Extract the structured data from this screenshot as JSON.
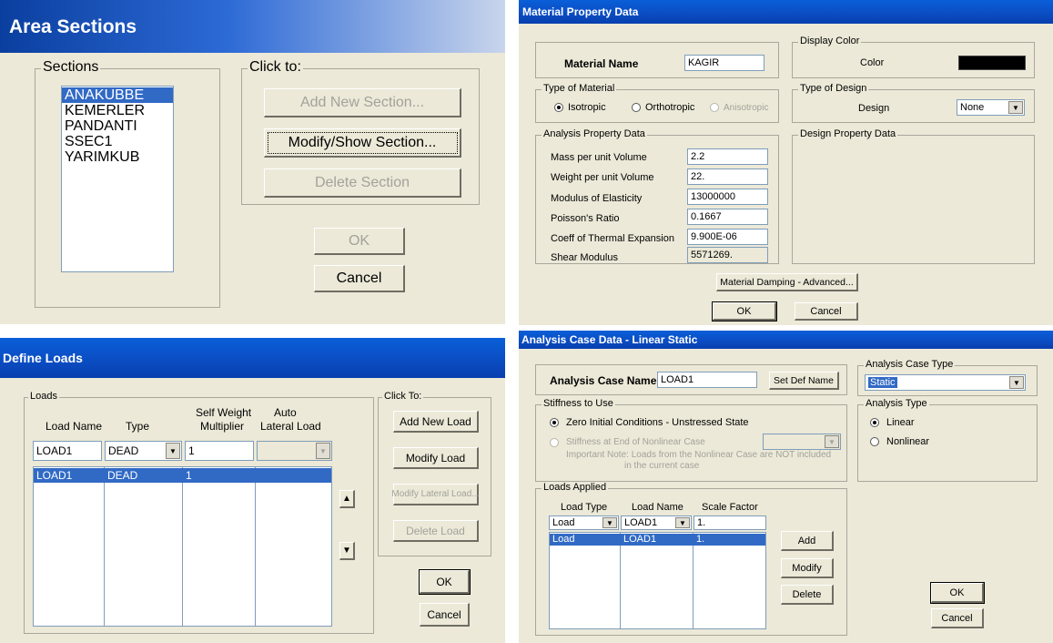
{
  "area_sections": {
    "title": "Area Sections",
    "sections_group": "Sections",
    "sections": [
      "ANAKUBBE",
      "KEMERLER",
      "PANDANTI",
      "SSEC1",
      "YARIMKUB"
    ],
    "click_group": "Click to:",
    "add_btn": "Add New Section...",
    "modify_btn": "Modify/Show Section...",
    "delete_btn": "Delete Section",
    "ok_btn": "OK",
    "cancel_btn": "Cancel"
  },
  "material": {
    "title": "Material Property Data",
    "name_label": "Material Name",
    "name_value": "KAGIR",
    "display_color_group": "Display Color",
    "color_label": "Color",
    "color_swatch": "#000000",
    "type_group": "Type of Material",
    "isotropic": "Isotropic",
    "orthotropic": "Orthotropic",
    "anisotropic": "Anisotropic",
    "design_group": "Type of Design",
    "design_label": "Design",
    "design_value": "None",
    "analysis_group": "Analysis Property Data",
    "props": [
      {
        "label": "Mass per unit Volume",
        "value": "2.2"
      },
      {
        "label": "Weight per unit Volume",
        "value": "22."
      },
      {
        "label": "Modulus of Elasticity",
        "value": "13000000"
      },
      {
        "label": "Poisson's Ratio",
        "value": "0.1667"
      },
      {
        "label": "Coeff of Thermal Expansion",
        "value": "9.900E-06"
      },
      {
        "label": "Shear Modulus",
        "value": "5571269."
      }
    ],
    "design_prop_group": "Design Property Data",
    "damping_btn": "Material Damping - Advanced...",
    "ok_btn": "OK",
    "cancel_btn": "Cancel"
  },
  "define_loads": {
    "title": "Define Loads",
    "loads_group": "Loads",
    "col_name": "Load Name",
    "col_type": "Type",
    "col_sw_1": "Self Weight",
    "col_sw_2": "Multiplier",
    "col_auto_1": "Auto",
    "col_auto_2": "Lateral Load",
    "input_name": "LOAD1",
    "input_type": "DEAD",
    "input_sw": "1",
    "row": {
      "name": "LOAD1",
      "type": "DEAD",
      "sw": "1",
      "auto": ""
    },
    "click_group": "Click To:",
    "add_btn": "Add New Load",
    "modify_btn": "Modify Load",
    "modify_lateral_btn": "Modify Lateral Load...",
    "delete_btn": "Delete Load",
    "ok_btn": "OK",
    "cancel_btn": "Cancel"
  },
  "analysis_case": {
    "title": "Analysis Case Data - Linear Static",
    "name_label": "Analysis Case Name",
    "name_value": "LOAD1",
    "set_def_btn": "Set Def Name",
    "case_type_group": "Analysis Case Type",
    "case_type_value": "Static",
    "stiffness_group": "Stiffness to Use",
    "zero_initial": "Zero Initial Conditions - Unstressed State",
    "stiffness_end": "Stiffness at End of Nonlinear Case",
    "note_1": "Important Note:  Loads from the Nonlinear Case are NOT included",
    "note_2": "in the current case",
    "analysis_type_group": "Analysis Type",
    "linear": "Linear",
    "nonlinear": "Nonlinear",
    "loads_group": "Loads Applied",
    "col_type": "Load Type",
    "col_name": "Load Name",
    "col_scale": "Scale Factor",
    "input_type": "Load",
    "input_name": "LOAD1",
    "input_scale": "1.",
    "row": {
      "type": "Load",
      "name": "LOAD1",
      "scale": "1."
    },
    "add_btn": "Add",
    "modify_btn": "Modify",
    "delete_btn": "Delete",
    "ok_btn": "OK",
    "cancel_btn": "Cancel"
  }
}
